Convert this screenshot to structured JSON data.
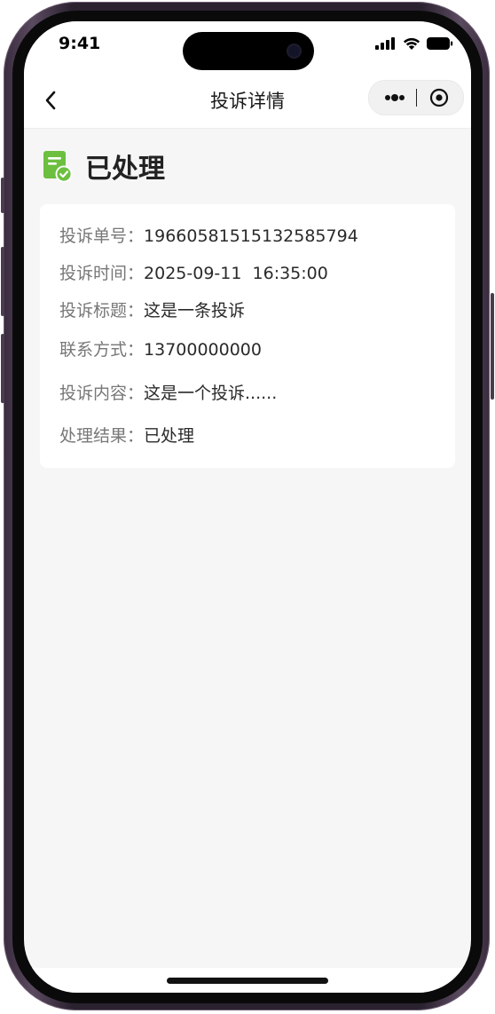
{
  "status_bar": {
    "time": "9:41"
  },
  "nav": {
    "title": "投诉详情"
  },
  "complaint": {
    "status_title": "已处理",
    "fields": [
      {
        "label": "投诉单号：",
        "value": "19660581515132585794"
      },
      {
        "label": "投诉时间：",
        "value": "2025-09-11  16:35:00"
      },
      {
        "label": "投诉标题：",
        "value": "这是一条投诉"
      },
      {
        "label": "联系方式：",
        "value": "13700000000"
      },
      {
        "label": "投诉内容：",
        "value": "这是一个投诉......"
      },
      {
        "label": "处理结果：",
        "value": "已处理"
      }
    ]
  },
  "colors": {
    "accent_green": "#6cbf3f",
    "page_background": "#f6f6f6",
    "card_background": "#ffffff"
  },
  "icons": {
    "back": "chevron-left-icon",
    "more": "more-dots-icon",
    "close": "capsule-close-icon",
    "status": "document-check-icon"
  }
}
